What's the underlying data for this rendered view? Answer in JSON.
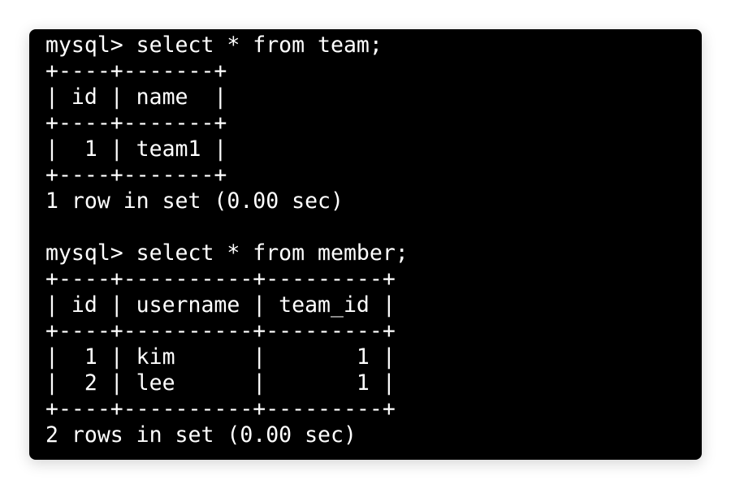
{
  "terminal": {
    "lines": [
      "mysql> select * from team;",
      "+----+-------+",
      "| id | name  |",
      "+----+-------+",
      "|  1 | team1 |",
      "+----+-------+",
      "1 row in set (0.00 sec)",
      "",
      "mysql> select * from member;",
      "+----+----------+---------+",
      "| id | username | team_id |",
      "+----+----------+---------+",
      "|  1 | kim      |       1 |",
      "|  2 | lee      |       1 |",
      "+----+----------+---------+",
      "2 rows in set (0.00 sec)"
    ]
  }
}
